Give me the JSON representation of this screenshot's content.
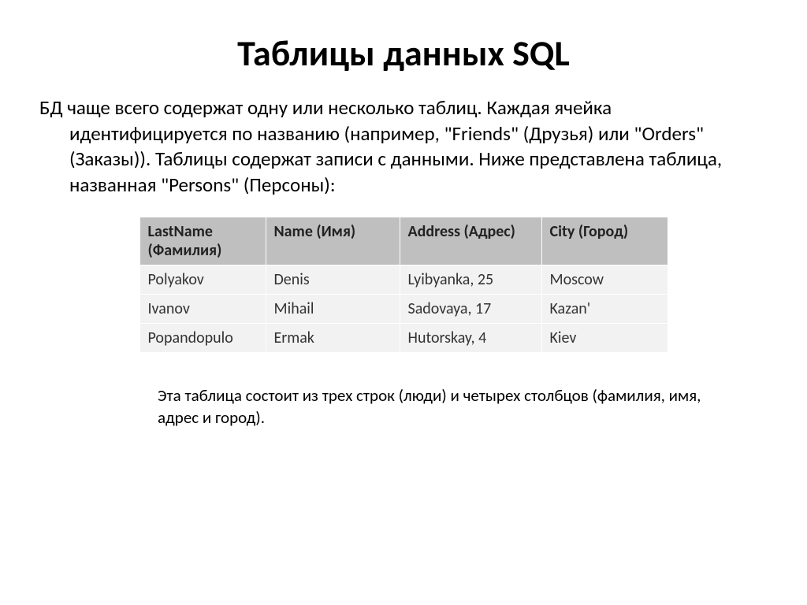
{
  "title": "Таблицы данных SQL",
  "intro": "БД чаще всего содержат одну или несколько таблиц. Каждая ячейка идентифицируется по названию (например, \"Friends\" (Друзья) или \"Orders\" (Заказы)). Таблицы содержат записи с данными. Ниже представлена таблица, названная \"Persons\" (Персоны):",
  "table": {
    "headers": {
      "lastname": "LastName (Фамилия)",
      "name": "Name (Имя)",
      "address": "Address (Адрес)",
      "city": "City (Город)"
    },
    "rows": [
      {
        "lastname": "Polyakov",
        "name": "Denis",
        "address": "Lyibyanka, 25",
        "city": "Moscow"
      },
      {
        "lastname": "Ivanov",
        "name": "Mihail",
        "address": "Sadovaya, 17",
        "city": "Kazan'"
      },
      {
        "lastname": "Popandopulo",
        "name": "Ermak",
        "address": "Hutorskay, 4",
        "city": "Kiev"
      }
    ]
  },
  "note": "Эта таблица состоит из трех строк (люди) и четырех столбцов (фамилия, имя, адрес и город)."
}
